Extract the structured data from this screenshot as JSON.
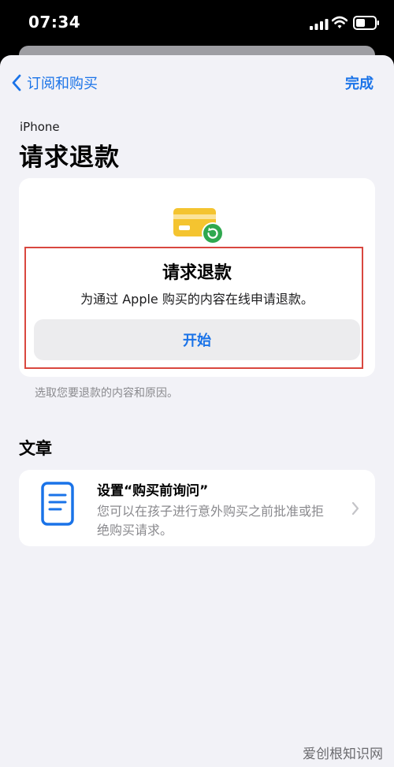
{
  "status_bar": {
    "time": "07:34",
    "icons": [
      "signal-icon",
      "wifi-icon",
      "battery-icon"
    ]
  },
  "nav": {
    "back_label": "订阅和购买",
    "done_label": "完成"
  },
  "header": {
    "eyebrow": "iPhone",
    "title": "请求退款"
  },
  "refund_card": {
    "icon": "credit-card-refund-icon",
    "title": "请求退款",
    "description": "为通过 Apple 购买的内容在线申请退款。",
    "start_label": "开始",
    "footer": "选取您要退款的内容和原因。"
  },
  "articles": {
    "section_title": "文章",
    "items": [
      {
        "icon": "document-icon",
        "title": "设置“购买前询问”",
        "description": "您可以在孩子进行意外购买之前批准或拒绝购买请求。"
      }
    ]
  },
  "watermark": "爱创根知识网",
  "colors": {
    "accent": "#1a73e8",
    "card_icon_yellow": "#f4c430",
    "refund_badge_green": "#2fa84f",
    "highlight_border": "#d9473f"
  }
}
